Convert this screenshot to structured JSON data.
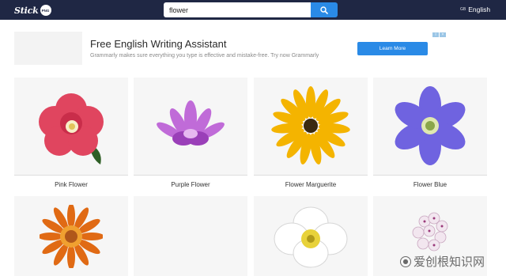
{
  "header": {
    "logo_text": "Stick",
    "logo_badge": "PNG",
    "search_value": "flower",
    "lang_code": "GB",
    "lang_label": "English"
  },
  "ad": {
    "title": "Free English Writing Assistant",
    "description": "Grammarly makes sure everything you type is effective and mistake-free. Try now Grammarly",
    "button_label": "Learn More"
  },
  "cards": [
    {
      "caption": "Pink Flower",
      "icon": "pink-flower-image"
    },
    {
      "caption": "Purple Flower",
      "icon": "purple-lotus-image"
    },
    {
      "caption": "Flower Marguerite",
      "icon": "yellow-daisy-image"
    },
    {
      "caption": "Flower Blue",
      "icon": "blue-anemone-image"
    },
    {
      "caption": "",
      "icon": "orange-strawflower-image"
    },
    {
      "caption": "",
      "icon": "blank-image"
    },
    {
      "caption": "",
      "icon": "white-poppy-image"
    },
    {
      "caption": "",
      "icon": "white-blossom-image"
    }
  ],
  "watermark": "爱创根知识网",
  "colors": {
    "header": "#1f2744",
    "accent": "#2a8ae6"
  }
}
